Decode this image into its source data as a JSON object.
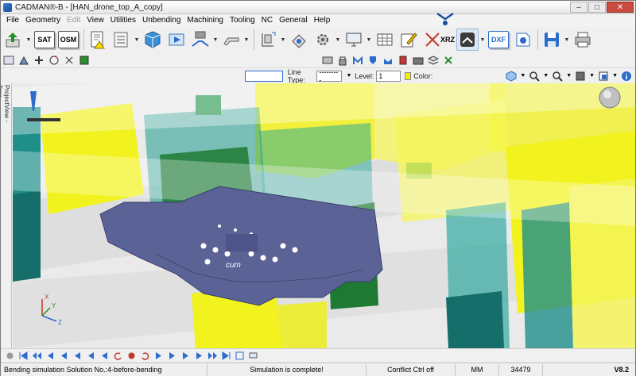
{
  "window": {
    "title": "CADMAN®-B - [HAN_drone_top_A_copy]",
    "controls": {
      "minimize": "–",
      "maximize": "□",
      "close": "✕"
    }
  },
  "menu": [
    {
      "label": "File",
      "disabled": false
    },
    {
      "label": "Geometry",
      "disabled": false
    },
    {
      "label": "Edit",
      "disabled": true
    },
    {
      "label": "View",
      "disabled": false
    },
    {
      "label": "Utilities",
      "disabled": false
    },
    {
      "label": "Unbending",
      "disabled": false
    },
    {
      "label": "Machining",
      "disabled": false
    },
    {
      "label": "Tooling",
      "disabled": false
    },
    {
      "label": "NC",
      "disabled": false
    },
    {
      "label": "General",
      "disabled": false
    },
    {
      "label": "Help",
      "disabled": false
    }
  ],
  "toolbar": {
    "sat_label": "SAT",
    "osm_label": "OSM",
    "xrz_label": "XRZ",
    "dxf_label": "DXF"
  },
  "properties_bar": {
    "line_type_label": "Line Type:",
    "line_type_value": "---------",
    "level_label": "Level:",
    "level_value": "1",
    "color_label": "Color:",
    "color_value": "#f5f000"
  },
  "side_panel": {
    "tab_label": "ProjectView - Tree"
  },
  "axes": {
    "x": "X",
    "y": "Y",
    "z": "Z"
  },
  "part_engraving": "cum",
  "status": {
    "message": "Bending simulation Solution No.:4-before-bending",
    "simulation": "Simulation is complete!",
    "conflict": "Conflict Ctrl off",
    "units": "MM",
    "count": "34479",
    "version": "V8.2"
  },
  "colors": {
    "tool_yellow": "#f2f21e",
    "tool_teal": "#1f8f8a",
    "tool_green": "#1e7a33",
    "part_blue": "#5a6296",
    "accent_blue": "#2c6dcc"
  }
}
